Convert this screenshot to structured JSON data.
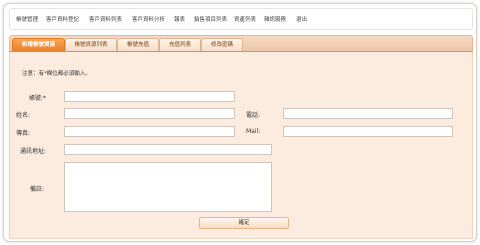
{
  "nav": {
    "items": [
      "帳號管理",
      "客戶資料登記",
      "客戶資料列表",
      "客戶資料分析",
      "報表",
      "銷售項目列表",
      "資產列表",
      "雜訊服務",
      "退出"
    ]
  },
  "tabs": [
    "新增帳號資源",
    "帳號資源列表",
    "帳號充值",
    "充值列表",
    "修改密碼"
  ],
  "form": {
    "note": "注意：有*欄位都必須輸入。",
    "account_label": "帳號:*",
    "name_label": "姓名:",
    "phone_label": "電話:",
    "fax_label": "傳真:",
    "mail_label": "Mail:",
    "address_label": "通訊地址:",
    "remark_label": "備註:",
    "submit_label": "確定"
  }
}
